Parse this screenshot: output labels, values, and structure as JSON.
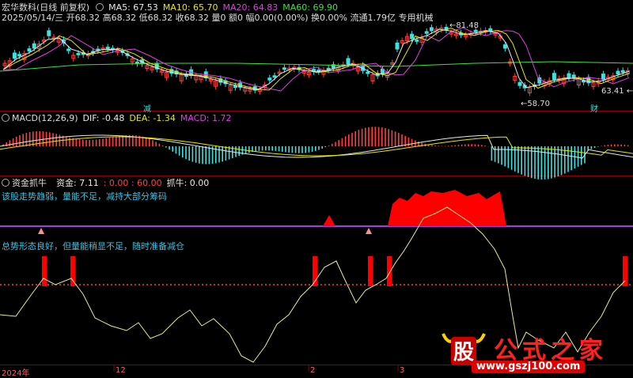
{
  "header": {
    "stock": "宏华数科(日线 前复权)",
    "ma5": "MA5: 67.53",
    "ma10": "MA10: 65.70",
    "ma20": "MA20: 64.83",
    "ma60": "MA60: 69.90",
    "info": "2025/05/14/三 开68.32 高68.32 低68.32 收68.32 量0 额0 幅0.00(0.00%) 换0.00% 流通1.79亿 专用机械"
  },
  "price_panel": {
    "annot_high": "81.48",
    "annot_low": "58.70",
    "annot_right": "63.41",
    "tag_jian": "减",
    "tag_cai": "财"
  },
  "macd_panel": {
    "title": "MACD(12,26,9)",
    "dif": "DIF: -0.48",
    "dea": "DEA: -1.34",
    "macd": "MACD: 1.72"
  },
  "capital_panel": {
    "title": "资金抓牛",
    "zijin": "资金: 7.11",
    "levels": ": 0.00 : 60.00",
    "zhuaniu": "抓牛: 0.00",
    "note1": "该股走势趋弱，量能不足，减持大部分筹码",
    "note2": "总势形态良好，但量能稍显不足，随时准备减仓"
  },
  "x_axis": {
    "labels": [
      "2024年",
      "12",
      "2",
      "3"
    ]
  },
  "watermark": {
    "title": "公式之家",
    "url": "www.gszj100.com",
    "glyph": "股"
  },
  "colors": {
    "ma5": "#e8e8e8",
    "ma10": "#e8e800",
    "ma20": "#e040e0",
    "ma60": "#40e040",
    "up": "#ff4040",
    "down": "#40e0e0",
    "capital_red": "#ff0000",
    "line_purple": "#a040e0",
    "dotted_red": "#ff4040"
  }
}
